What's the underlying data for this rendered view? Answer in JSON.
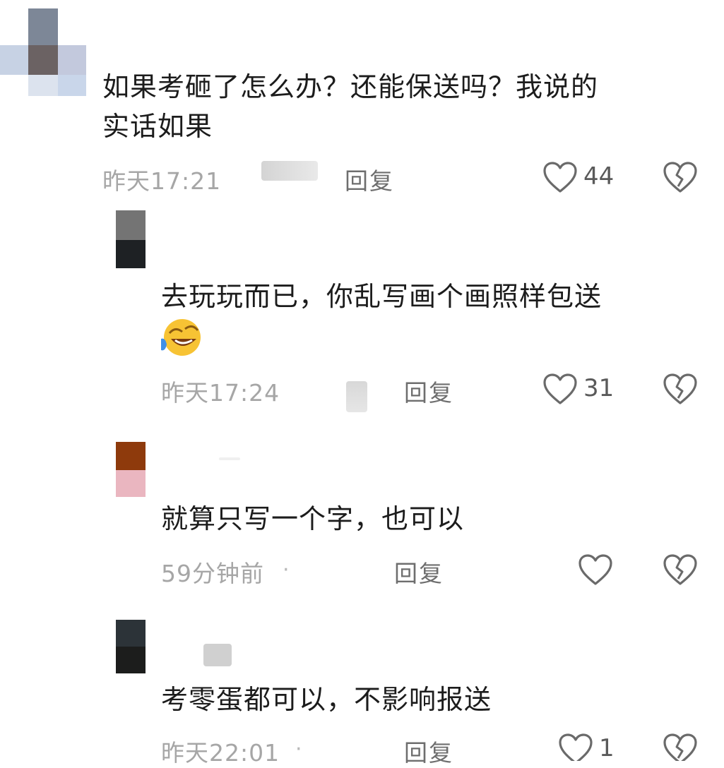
{
  "comments": [
    {
      "text_line1": "如果考砸了怎么办？还能保送吗？我说的",
      "text_line2": "实话如果",
      "time": "昨天17:21",
      "reply_label": "回复",
      "likes": "44"
    },
    {
      "text_line1": "去玩玩而已，你乱写画个画照样包送",
      "time": "昨天17:24",
      "reply_label": "回复",
      "likes": "31"
    },
    {
      "text_line1": "就算只写一个字，也可以",
      "time": "59分钟前",
      "dot": "·",
      "reply_label": "回复",
      "likes": ""
    },
    {
      "text_line1": "考零蛋都可以，不影响报送",
      "time": "昨天22:01",
      "dot": "·",
      "reply_label": "回复",
      "likes": "1"
    }
  ],
  "icons": {
    "like": "heart-outline-icon",
    "dislike": "broken-heart-icon",
    "emoji": "laughing-crying-emoji-icon"
  },
  "colors": {
    "text": "#1c1c1c",
    "meta": "#a6a6a6",
    "icon": "#6a6a6a"
  }
}
